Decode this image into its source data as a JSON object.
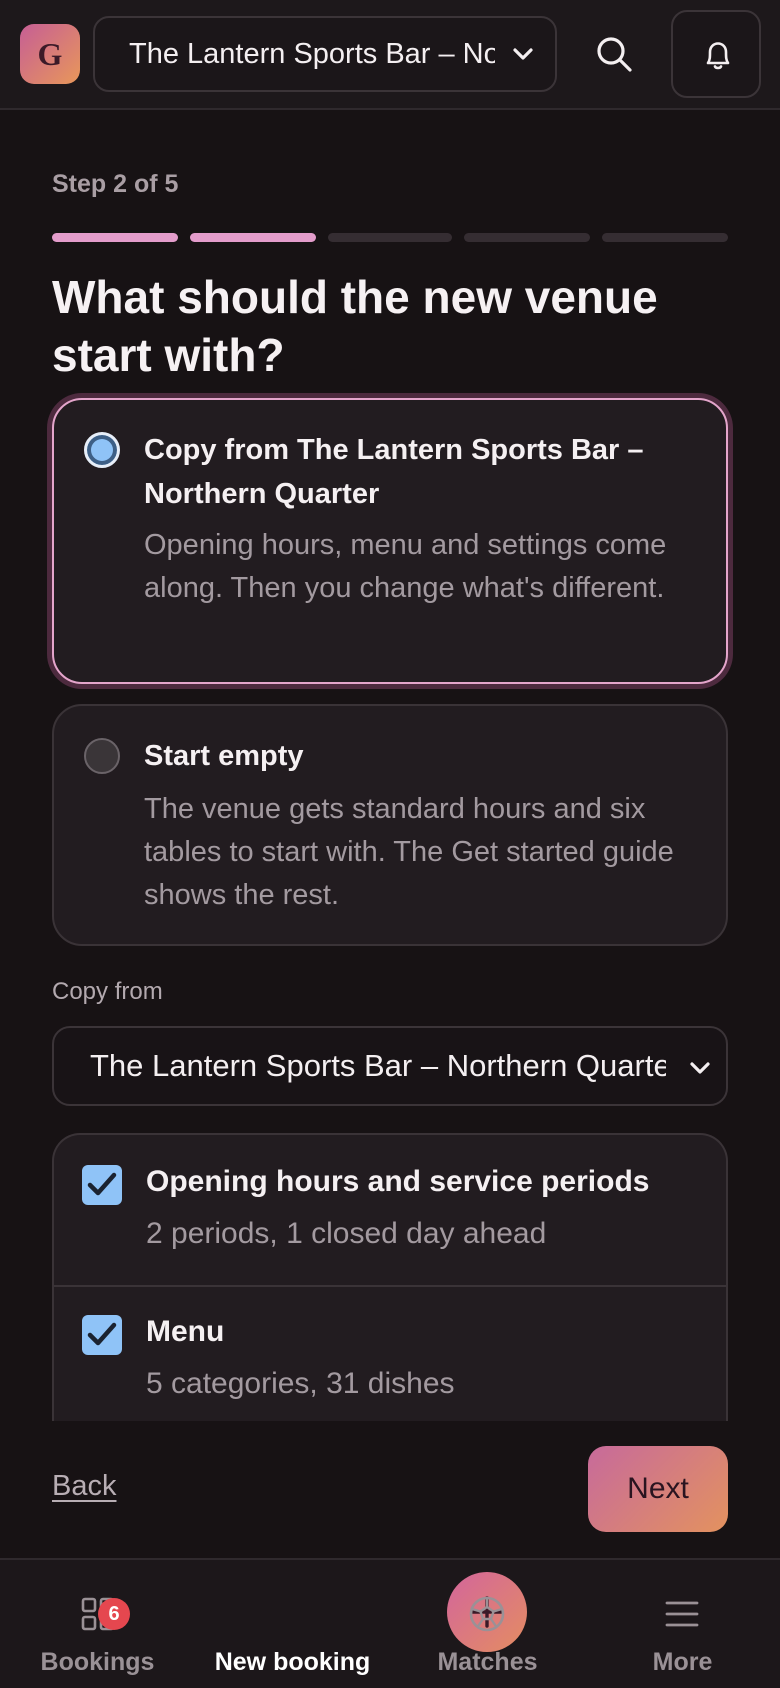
{
  "header": {
    "logo_letter": "G",
    "venue_selected": "The Lantern Sports Bar – Northern Quarter",
    "search_icon": "search-icon",
    "bell_icon": "bell-icon"
  },
  "wizard": {
    "step_label": "Step 2 of 5",
    "current_step": 2,
    "total_steps": 5,
    "title": "What should the new venue start with?",
    "options": [
      {
        "title": "Copy from The Lantern Sports Bar – Northern Quarter",
        "description": "Opening hours, menu and settings come along. Then you change what's different.",
        "selected": true
      },
      {
        "title": "Start empty",
        "description": "The venue gets standard hours and six tables to start with. The Get started guide shows the rest.",
        "selected": false
      }
    ],
    "copy_from_label": "Copy from",
    "copy_from_value": "The Lantern Sports Bar – Northern Quarter",
    "items": [
      {
        "title": "Opening hours and service periods",
        "subtitle": "2 periods, 1 closed day ahead",
        "checked": true
      },
      {
        "title": "Menu",
        "subtitle": "5 categories, 31 dishes",
        "checked": true
      }
    ],
    "back_label": "Back",
    "next_label": "Next"
  },
  "bottom_nav": {
    "items": [
      {
        "label": "Bookings",
        "icon": "grid-icon",
        "badge": "6"
      },
      {
        "label": "New booking",
        "icon": "plus-icon"
      },
      {
        "label": "Matches",
        "icon": "football-icon"
      },
      {
        "label": "More",
        "icon": "menu-icon"
      }
    ]
  },
  "colors": {
    "accent": "#e39ccb",
    "gradient_start": "#c65e95",
    "gradient_end": "#e8975a",
    "checkbox": "#8fc3f7",
    "badge": "#e5474f"
  }
}
